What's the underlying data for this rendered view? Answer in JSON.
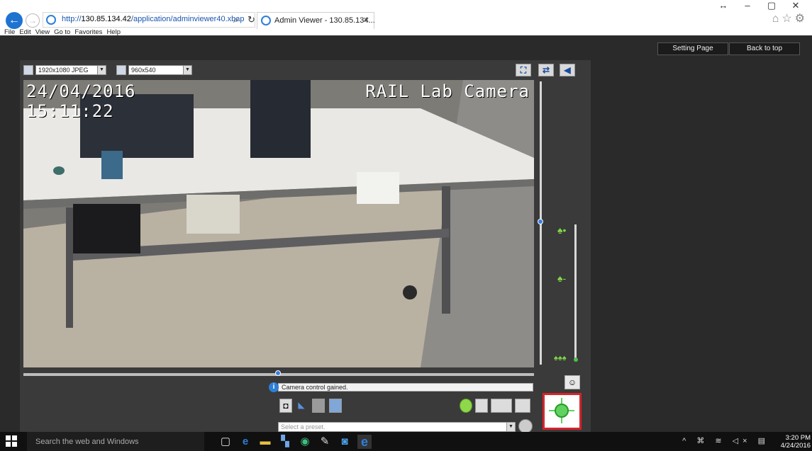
{
  "browser": {
    "address_scheme": "http://",
    "address_host": "130.85.134.42",
    "address_path": "/application/adminviewer40.xbap",
    "tab_title": "Admin Viewer - 130.85.134...",
    "menu": [
      "File",
      "Edit",
      "View",
      "Go to",
      "Favorites",
      "Help"
    ],
    "window_controls": [
      "↔",
      "–",
      "▢",
      "✕"
    ]
  },
  "app": {
    "setting_page_label": "Setting Page",
    "back_to_top_label": "Back to top",
    "resolution_select": "1920x1080 JPEG",
    "display_select": "960x540",
    "osd_date": "24/04/2016",
    "osd_time": "15:11:22",
    "osd_title": "RAIL Lab Camera",
    "status_message": "Camera control gained.",
    "preset_placeholder": "Select a preset."
  },
  "taskbar": {
    "search_placeholder": "Search the web and Windows",
    "time": "3:20 PM",
    "date": "4/24/2016",
    "tray_icons": "^ ⌘ ≋ ◁× ▤"
  },
  "colors": {
    "highlight_border": "#d8232a",
    "accent_blue": "#2d7fd8",
    "zoom_green": "#5fd25f"
  }
}
